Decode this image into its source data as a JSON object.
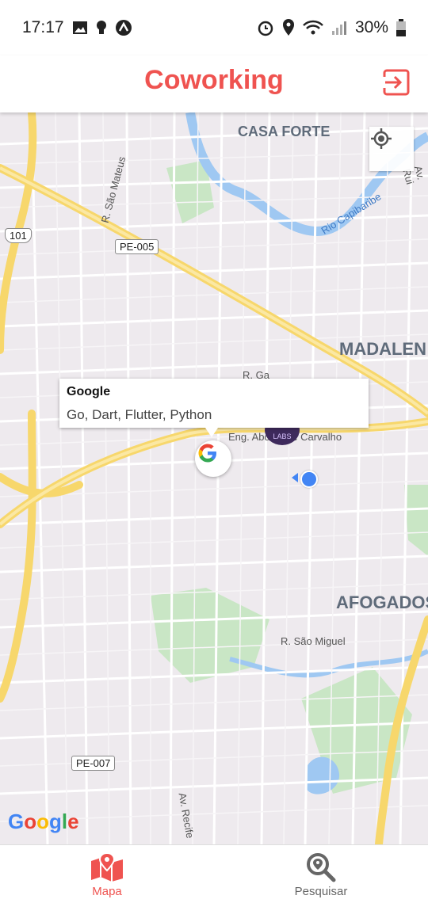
{
  "status_bar": {
    "time": "17:17",
    "battery": "30%",
    "left_icons": [
      "image-icon",
      "lightbulb-icon",
      "a-icon"
    ],
    "right_icons": [
      "alarm-icon",
      "location-icon",
      "wifi-icon",
      "signal-icon",
      "battery-icon"
    ]
  },
  "appbar": {
    "title": "Coworking",
    "title_color": "#ef5350",
    "exit_icon": "exit-icon"
  },
  "map": {
    "labels": {
      "casa_forte": "CASA FORTE",
      "madalena": "MADALEN",
      "afogados": "AFOGADOS"
    },
    "roads": {
      "sao_mateus": "R. São Mateus",
      "pe005": "PE-005",
      "br101": "101",
      "rio_capibaribe": "Rio Capibaribe",
      "r_ga": "R. Ga",
      "eng_abdias": "Eng. Abdias de Carvalho",
      "sao_miguel": "R. São Miguel",
      "pe007": "PE-007",
      "av_recife": "Av. Recife",
      "av_rui": "Av. Rui"
    },
    "info_window": {
      "title": "Google",
      "subtitle": "Go, Dart, Flutter, Python"
    },
    "second_marker_text": "LABS",
    "google_logo": "Google"
  },
  "bottom_nav": {
    "items": [
      {
        "label": "Mapa",
        "icon": "map-icon",
        "color": "#ef5350"
      },
      {
        "label": "Pesquisar",
        "icon": "search-icon",
        "color": "#666666"
      }
    ]
  }
}
